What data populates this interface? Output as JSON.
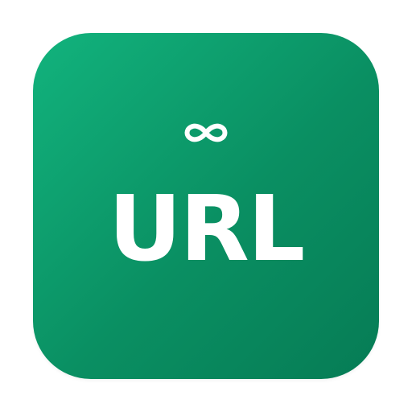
{
  "icon": {
    "label": "URL",
    "glyph": "infinity-icon",
    "background_start": "#12b37d",
    "background_end": "#067c55",
    "foreground": "#ffffff"
  }
}
